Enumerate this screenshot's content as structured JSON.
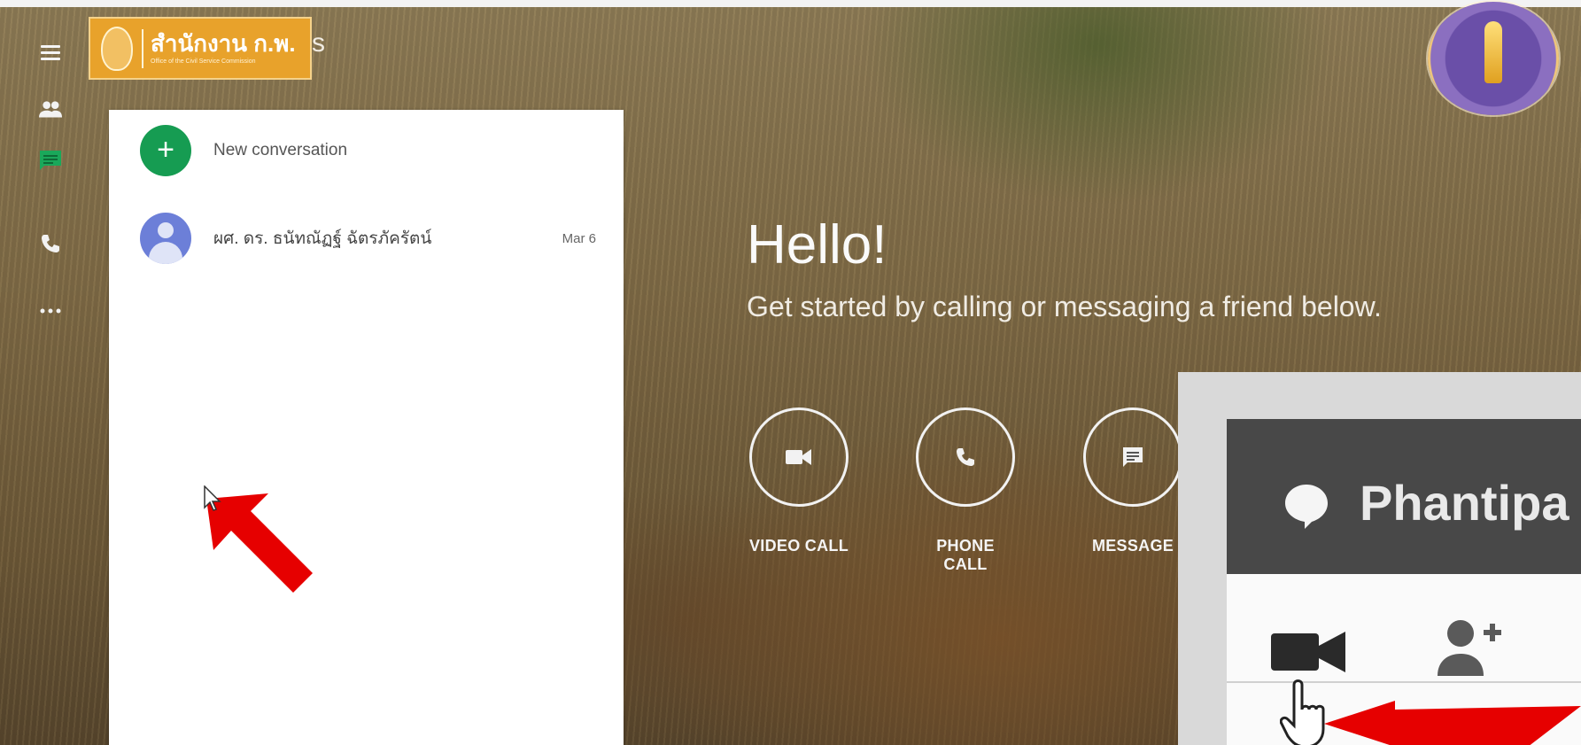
{
  "brand": {
    "logo_text": "สำนักงาน ก.พ.",
    "logo_subtext": "Office of the Civil Service Commission",
    "app_name_tail": "s"
  },
  "rail": {
    "items": [
      {
        "name": "menu",
        "icon": "hamburger-icon"
      },
      {
        "name": "contacts",
        "icon": "people-icon"
      },
      {
        "name": "conversations",
        "icon": "chat-icon",
        "active": true
      },
      {
        "name": "phone-calls",
        "icon": "phone-icon"
      },
      {
        "name": "more",
        "icon": "more-horizontal-icon"
      }
    ]
  },
  "conversations": {
    "new_label": "New conversation",
    "items": [
      {
        "name": "ผศ. ดร. ธนัทณัฏฐ์ ฉัตรภัครัตน์",
        "date": "Mar 6"
      }
    ]
  },
  "main": {
    "greeting": "Hello!",
    "subtitle": "Get started by calling or messaging a friend below.",
    "actions": [
      {
        "label": "VIDEO CALL",
        "icon": "videocam-icon"
      },
      {
        "label": "PHONE CALL",
        "icon": "phone-icon"
      },
      {
        "label": "MESSAGE",
        "icon": "message-icon"
      }
    ]
  },
  "inset": {
    "title": "Phantipa"
  },
  "colors": {
    "accent_green": "#169c52",
    "avatar_blue": "#6c7fd8",
    "logo_orange": "#e8a22b",
    "arrow_red": "#e60000"
  }
}
